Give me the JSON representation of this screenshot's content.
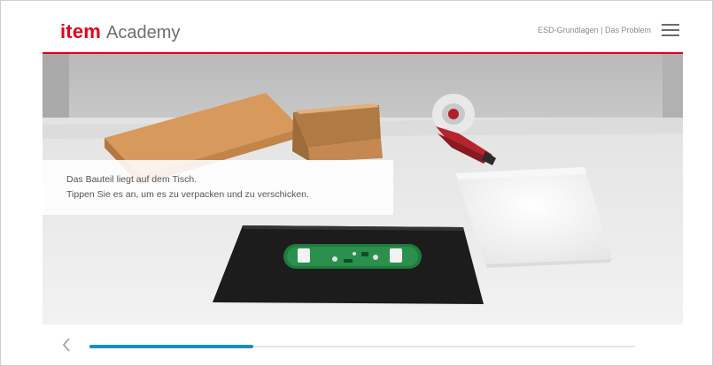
{
  "header": {
    "logo_brand": "item",
    "logo_sub": "Academy",
    "breadcrumb": "ESD-Grundlagen | Das Problem",
    "menu_icon": "hamburger-menu-icon"
  },
  "colors": {
    "brand_red": "#e2001a",
    "progress_blue": "#1a8ec2",
    "text_grey": "#555555"
  },
  "scene": {
    "description_objects": [
      "cardboard-box",
      "tape-dispenser",
      "plastic-bag",
      "esd-mat",
      "circuit-board"
    ]
  },
  "info": {
    "line1": "Das Bauteil liegt auf dem Tisch.",
    "line2": "Tippen Sie es an, um es zu verpacken und zu verschicken."
  },
  "footer": {
    "back_icon": "chevron-left-icon",
    "progress": 0.3
  }
}
